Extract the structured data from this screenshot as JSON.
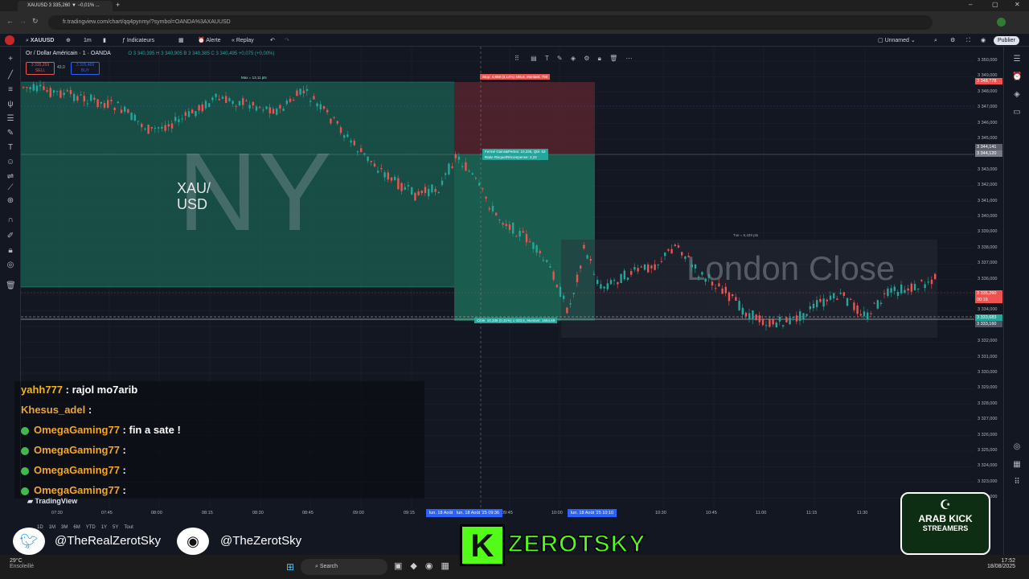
{
  "browser": {
    "tab_title": "XAUUSD 3 335,260 ▼ −0,01% ...",
    "url": "fr.tradingview.com/chart/qq4pynmy/?symbol=OANDA%3AXAUUSD"
  },
  "toolbar": {
    "symbol": "XAUUSD",
    "interval": "1m",
    "indicators": "Indicateurs",
    "alert": "Alerte",
    "replay": "Replay",
    "layout_name": "Unnamed",
    "publish": "Publier"
  },
  "legend": {
    "title": "Or / Dollar Américain · 1 · OANDA",
    "ohlc": "O 3 340,395  H 3 340,905  B 3 340,385  C 3 340,495  +0,075 (+0,00%)",
    "sell_price": "3 335,259",
    "sell_label": "SELL",
    "spread": "43,0",
    "buy_price": "3 335,489",
    "buy_label": "BUY"
  },
  "watermarks": {
    "session_ny": "NY",
    "pair": "XAU/ USD",
    "london_close": "London Close"
  },
  "position": {
    "stop_label": "Stop: 4,658 (0,14%) 465,8, Montant: 750",
    "info_label": "Fermé Gains&Pertes: 10,335, Qté: 53",
    "ratio_label": "Ratio Risque/Récompense: 2,22",
    "target_label": "Cible: 10,335 (0,31%) 1 033,5, Montant: 1554,69",
    "range_label_1": "Max = 13,11 pts",
    "range_label_2": "Txe = 6,429 pts"
  },
  "price_axis": {
    "ticks": [
      "3 350,000",
      "3 349,000",
      "3 348,000",
      "3 347,000",
      "3 346,000",
      "3 345,000",
      "3 344,000",
      "3 343,000",
      "3 342,000",
      "3 341,000",
      "3 340,000",
      "3 339,000",
      "3 338,000",
      "3 337,000",
      "3 336,000",
      "3 335,000",
      "3 334,000",
      "3 333,000",
      "3 332,000",
      "3 331,000",
      "3 330,000",
      "3 329,000",
      "3 328,000",
      "3 327,000",
      "3 326,000",
      "3 325,000",
      "3 324,000",
      "3 323,000",
      "3 322,000"
    ],
    "label_stop": "3 348,778",
    "label_entry": "3 344,141",
    "label_entry2": "3 344,120",
    "label_last": "3 335,260",
    "label_last_time": "00:16",
    "label_target": "3 333,683",
    "label_target2": "3 333,160"
  },
  "time_axis": {
    "ticks": [
      "07:30",
      "07:45",
      "08:00",
      "08:15",
      "08:30",
      "08:45",
      "09:00",
      "09:15",
      "09:45",
      "10:00",
      "10:30",
      "10:45",
      "11:00",
      "11:15",
      "11:30"
    ],
    "sel1": "lun. 18 Août",
    "sel2": "lun. 18 Août '25  09:36",
    "sel3": "lun. 18 Août '25  10:10"
  },
  "range_bar": {
    "items": [
      "1D",
      "1M",
      "3M",
      "6M",
      "YTD",
      "1Y",
      "5Y",
      "Tout"
    ]
  },
  "tv_logo": "TradingView",
  "chat": [
    {
      "user": "yahh777",
      "msg": ": rajol mo7arib",
      "verified": false
    },
    {
      "user": "Khesus_adel",
      "msg": ": ",
      "verified": false
    },
    {
      "user": "OmegaGaming77",
      "msg": ": fin a sate !",
      "verified": true
    },
    {
      "user": "OmegaGaming77",
      "msg": ": ",
      "verified": true
    },
    {
      "user": "OmegaGaming77",
      "msg": ": ",
      "verified": true
    },
    {
      "user": "OmegaGaming77",
      "msg": ": ",
      "verified": true
    }
  ],
  "overlay": {
    "twitter": "@TheRealZerotSky",
    "instagram": "@TheZerotSky",
    "brand": "ZEROTSKY",
    "badge_top": "ARAB KICK",
    "badge_bottom": "STREAMERS"
  },
  "taskbar": {
    "weather_temp": "29°C",
    "weather_desc": "Ensoleillé",
    "search": "Search",
    "time": "17:52",
    "date": "18/08/2025"
  },
  "colors": {
    "bg": "#131722",
    "up": "#26a69a",
    "down": "#ef5350",
    "target_zone": "#1f8a6a",
    "stop_zone": "#7a2a35"
  }
}
